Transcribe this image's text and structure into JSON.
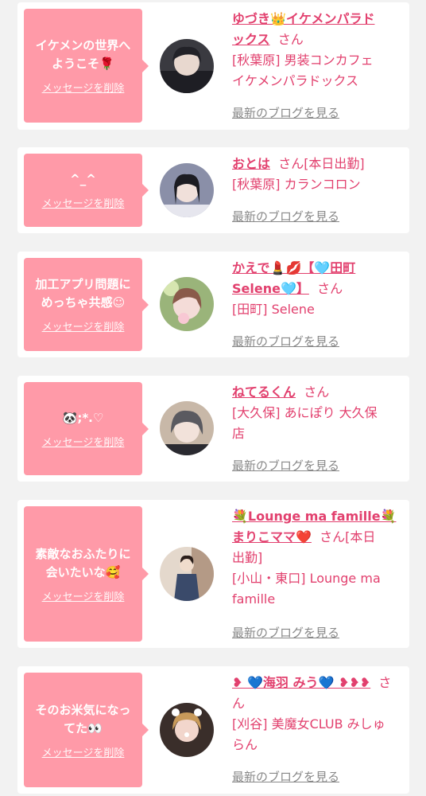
{
  "delete_label": "メッセージを削除",
  "blog_label": "最新のブログを見る",
  "colors": {
    "accent": "#e2406e",
    "bubble": "#ff9aa8",
    "background": "#f2f2f2"
  },
  "cards": [
    {
      "message_lines": [
        "イケメンの世界へ",
        "ようこそ🌹"
      ],
      "name_line1": "ゆづき👑イケメンパラド",
      "name_line2": "ックス",
      "san": "さん",
      "shop_line1": "[秋葉原] 男装コンカフェ",
      "shop_line2": "イケメンパラドックス"
    },
    {
      "message_lines": [
        "^_^"
      ],
      "name_line1": "おとは",
      "san": "さん[本日出勤]",
      "shop_line1": "[秋葉原] カランコロン"
    },
    {
      "message_lines": [
        "加工アプリ問題に",
        "めっちゃ共感☺"
      ],
      "name_line1": "かえで💄💋【🩵田町",
      "name_line2": "Selene🩵】",
      "san": "さん",
      "shop_line1": "[田町] Selene"
    },
    {
      "message_lines": [
        "🐼;*.♡"
      ],
      "name_line1": "ねてるくん",
      "san": "さん",
      "shop_line1": "[大久保] あにぽり 大久保",
      "shop_line2": "店"
    },
    {
      "message_lines": [
        "素敵なおふたりに",
        "会いたいな🥰"
      ],
      "name_line1": "💐Lounge ma famille💐",
      "name_line2": "まりこママ❤️",
      "san": "さん[本日",
      "san_line2": "出勤]",
      "shop_line1": "[小山・東口] Lounge ma",
      "shop_line2": "famille"
    },
    {
      "message_lines": [
        "そのお米気になっ",
        "てた👀"
      ],
      "name_line1": "❥ 💙海羽 みう💙 ❥❥❥",
      "san": "さ",
      "san_line2": "ん",
      "shop_line1": "[刈谷] 美魔女CLUB みしゅ",
      "shop_line2": "らん"
    }
  ]
}
